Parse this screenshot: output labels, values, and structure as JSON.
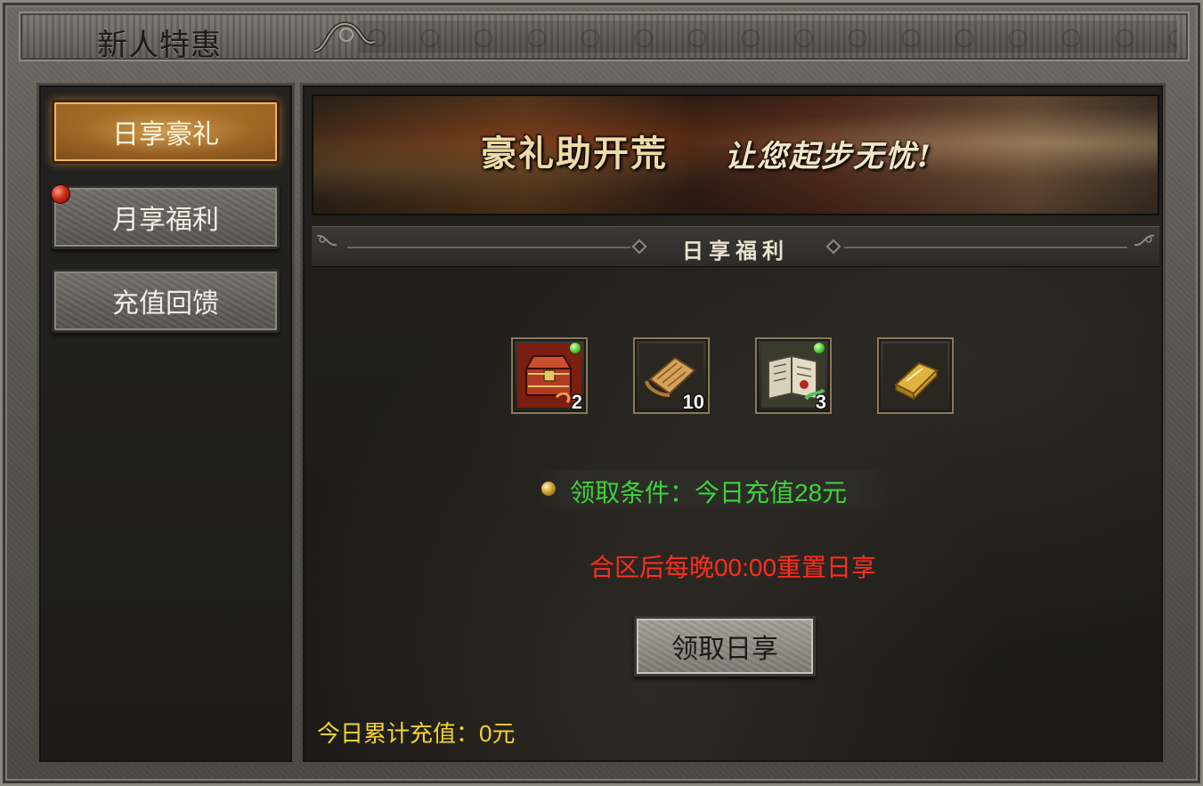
{
  "window": {
    "title": "新人特惠"
  },
  "sidebar": {
    "items": [
      {
        "label": "日享豪礼",
        "active": true,
        "notification": false
      },
      {
        "label": "月享福利",
        "active": false,
        "notification": true
      },
      {
        "label": "充值回馈",
        "active": false,
        "notification": false
      }
    ]
  },
  "banner": {
    "title": "豪礼助开荒",
    "subtitle": "让您起步无忧!"
  },
  "section": {
    "title": "日享福利"
  },
  "rewards": [
    {
      "icon": "treasure-chest-icon",
      "count": "2",
      "badge": true
    },
    {
      "icon": "scroll-icon",
      "count": "10",
      "badge": false
    },
    {
      "icon": "skill-book-icon",
      "count": "3",
      "badge": true
    },
    {
      "icon": "gold-bar-icon",
      "count": "",
      "badge": false
    }
  ],
  "condition": {
    "text": "领取条件：今日充值28元"
  },
  "notice": {
    "text": "合区后每晚00:00重置日享"
  },
  "actions": {
    "claim_label": "领取日享"
  },
  "footer": {
    "total_text": "今日累计充值：0元"
  },
  "colors": {
    "condition": "#3fd23a",
    "notice": "#ff2d1e",
    "total": "#f3d230",
    "active_tab": "#a36c2a"
  }
}
